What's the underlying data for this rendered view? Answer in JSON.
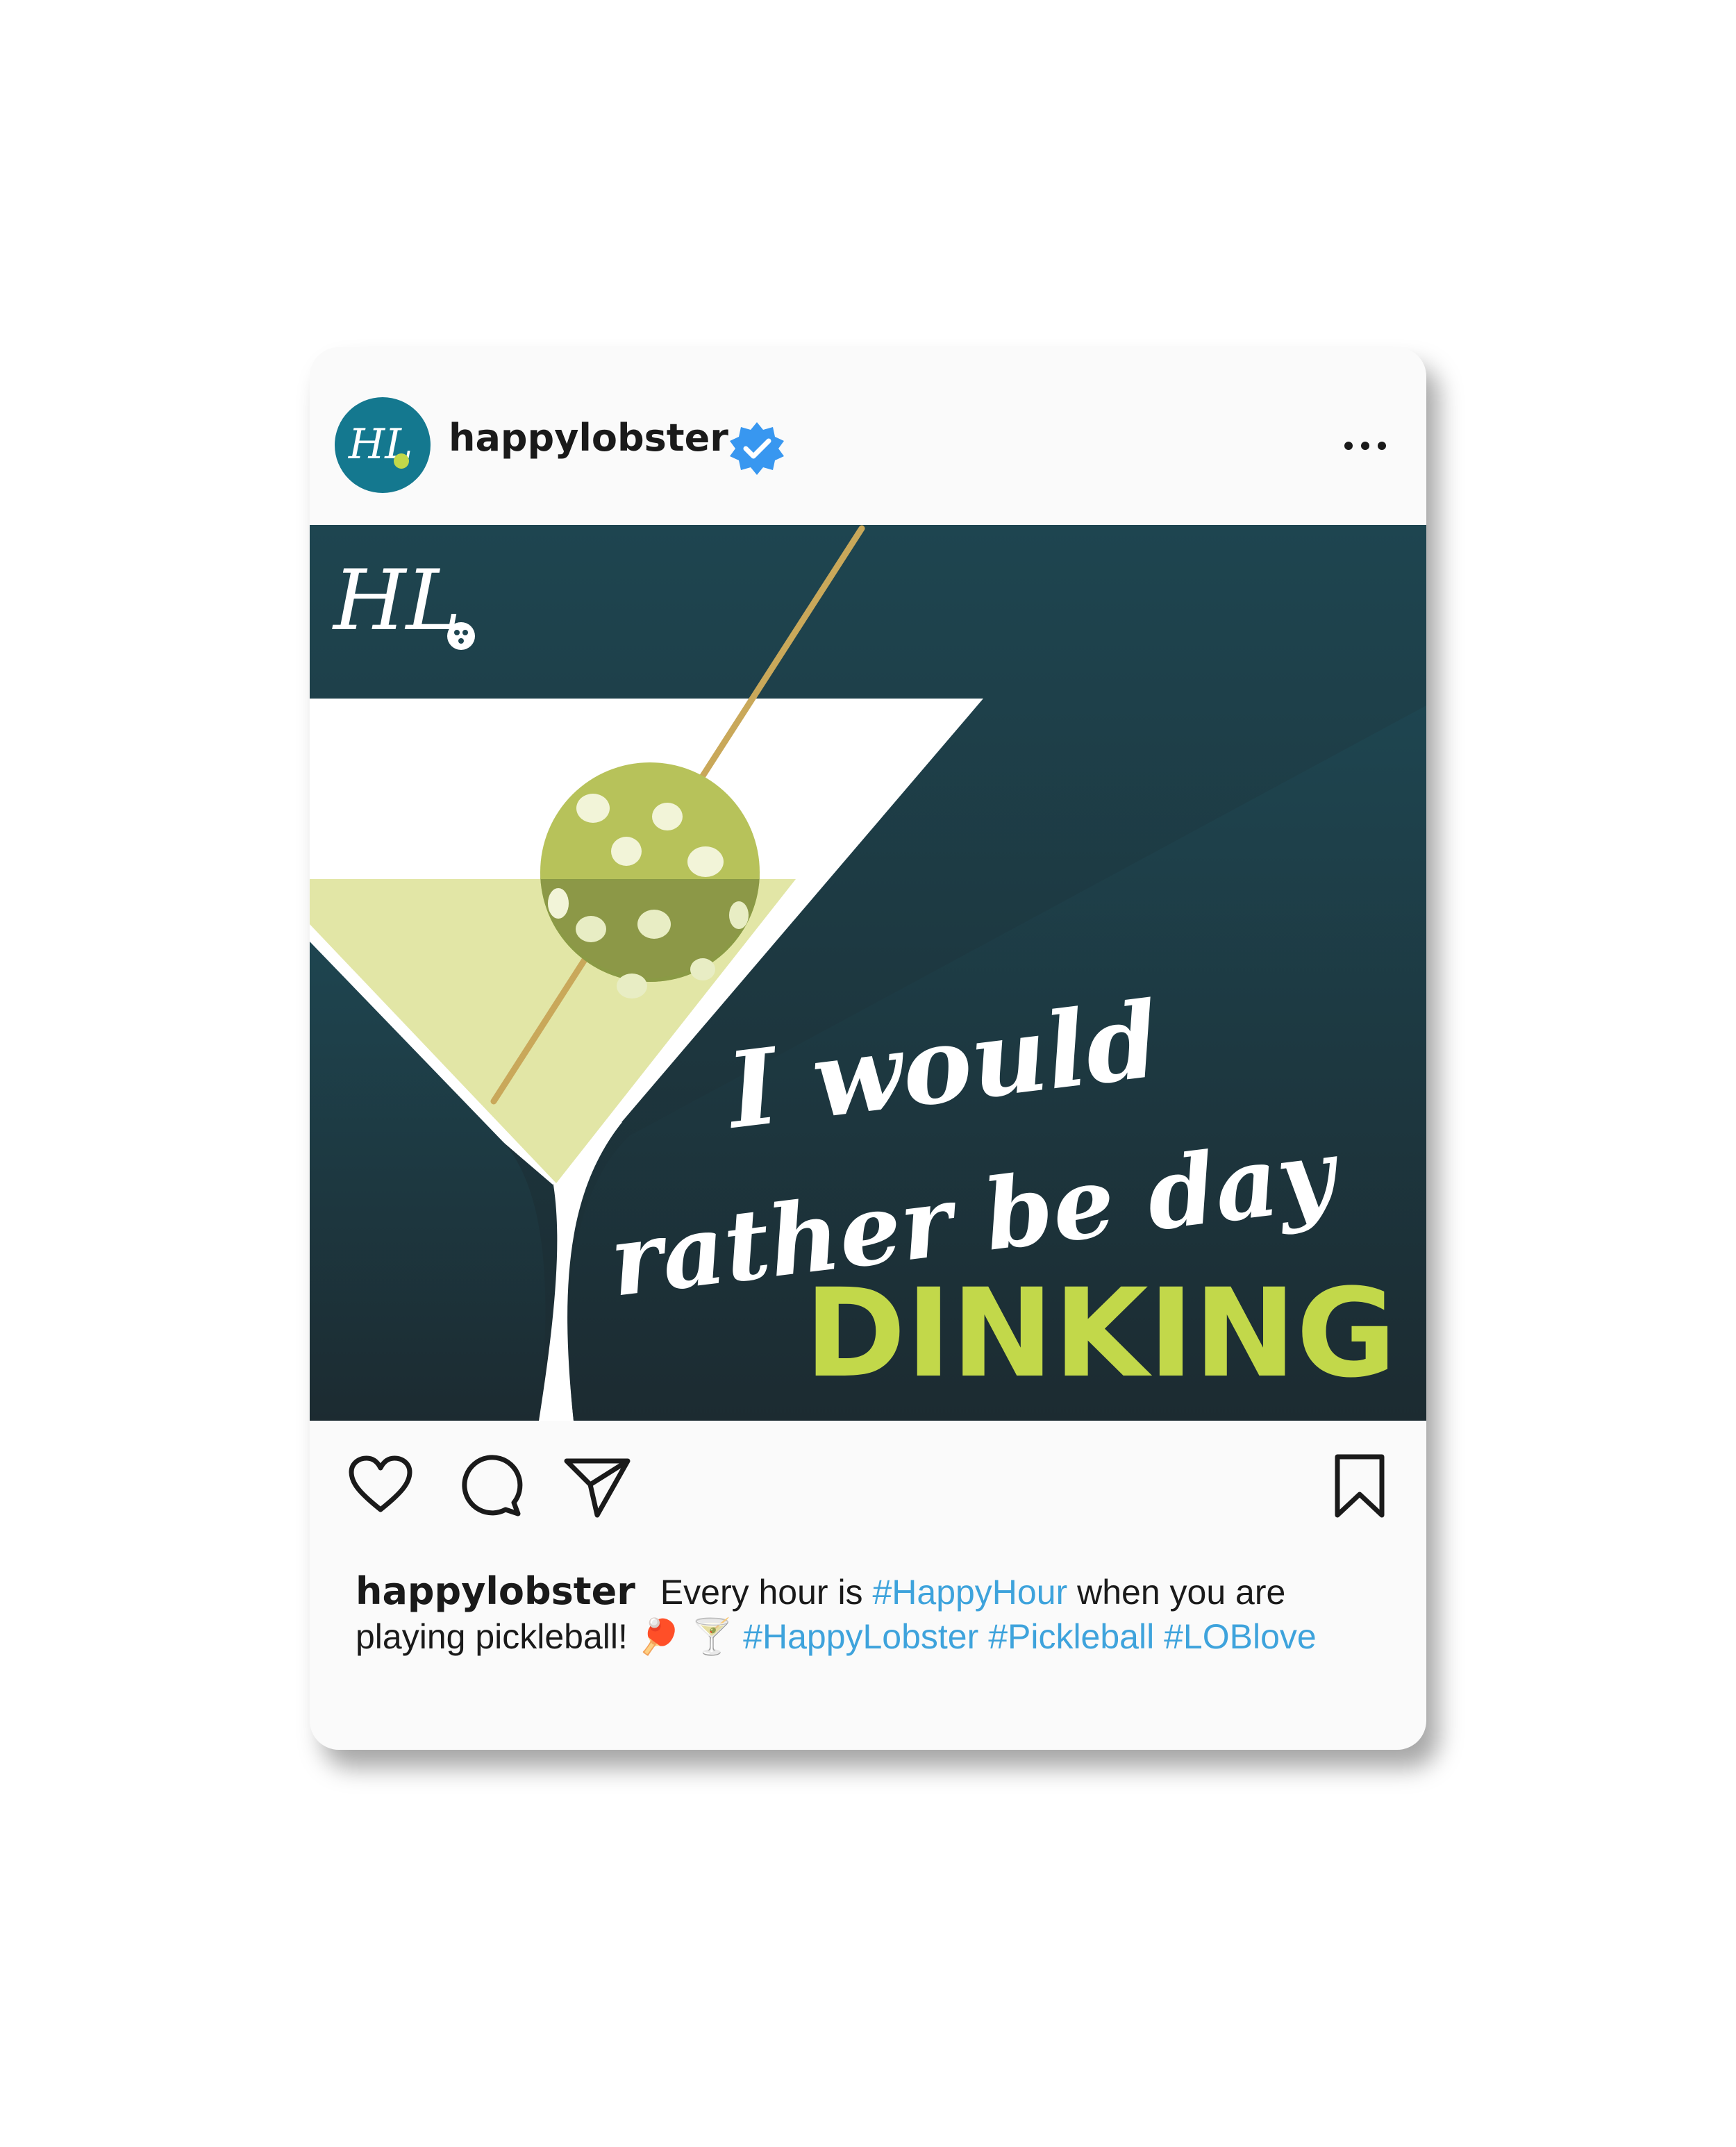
{
  "post": {
    "username": "happylobster",
    "verified": true,
    "avatar_text": "HL",
    "more_icon": "more-horizontal-icon"
  },
  "image": {
    "logo_text": "HL",
    "headline_line1": "I would",
    "headline_line2": "rather be day",
    "headline_emphasis": "DINKING",
    "colors": {
      "background_top": "#1e4550",
      "background_bottom": "#1c2b31",
      "glass": "#ffffff",
      "drink": "#e2e6a6",
      "ball": "#b7c25a",
      "emphasis": "#c2d84a",
      "toothpick": "#c9a85a"
    }
  },
  "actions": {
    "like_icon": "heart-icon",
    "comment_icon": "comment-icon",
    "share_icon": "send-icon",
    "save_icon": "bookmark-icon"
  },
  "caption": {
    "username": "happylobster",
    "text_1": "Every hour is",
    "tag_1": "#HappyHour",
    "text_2": "when you are playing pickleball!",
    "emoji_1": "🏓",
    "emoji_2": "🍸",
    "tag_2": "#HappyLobster",
    "tag_3": "#Pickleball",
    "tag_4": "#LOBlove"
  },
  "colors": {
    "hashtag": "#3ea3dc",
    "avatar_bg": "#14788f",
    "verified_badge": "#3897f0"
  }
}
